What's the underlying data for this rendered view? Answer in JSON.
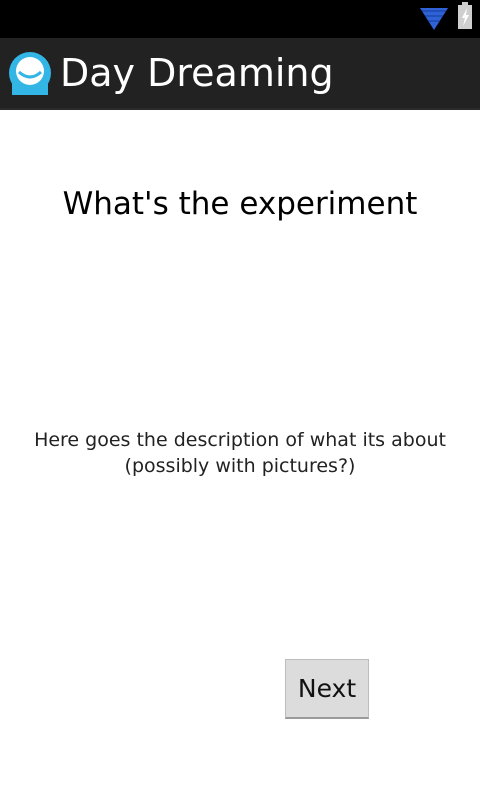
{
  "status_bar": {
    "wifi_icon": "wifi-icon",
    "battery_icon": "battery-charging-icon"
  },
  "action_bar": {
    "app_icon": "app-logo-icon",
    "title": "Day Dreaming"
  },
  "main": {
    "heading": "What's the experiment",
    "description_line1": "Here goes the description of what its about",
    "description_line2": "(possibly with pictures?)",
    "next_label": "Next"
  },
  "colors": {
    "status_bar_bg": "#000000",
    "action_bar_bg": "#222222",
    "wifi_blue": "#2f62d6",
    "app_icon_blue": "#33b5e5",
    "button_bg": "#dcdcdc"
  }
}
